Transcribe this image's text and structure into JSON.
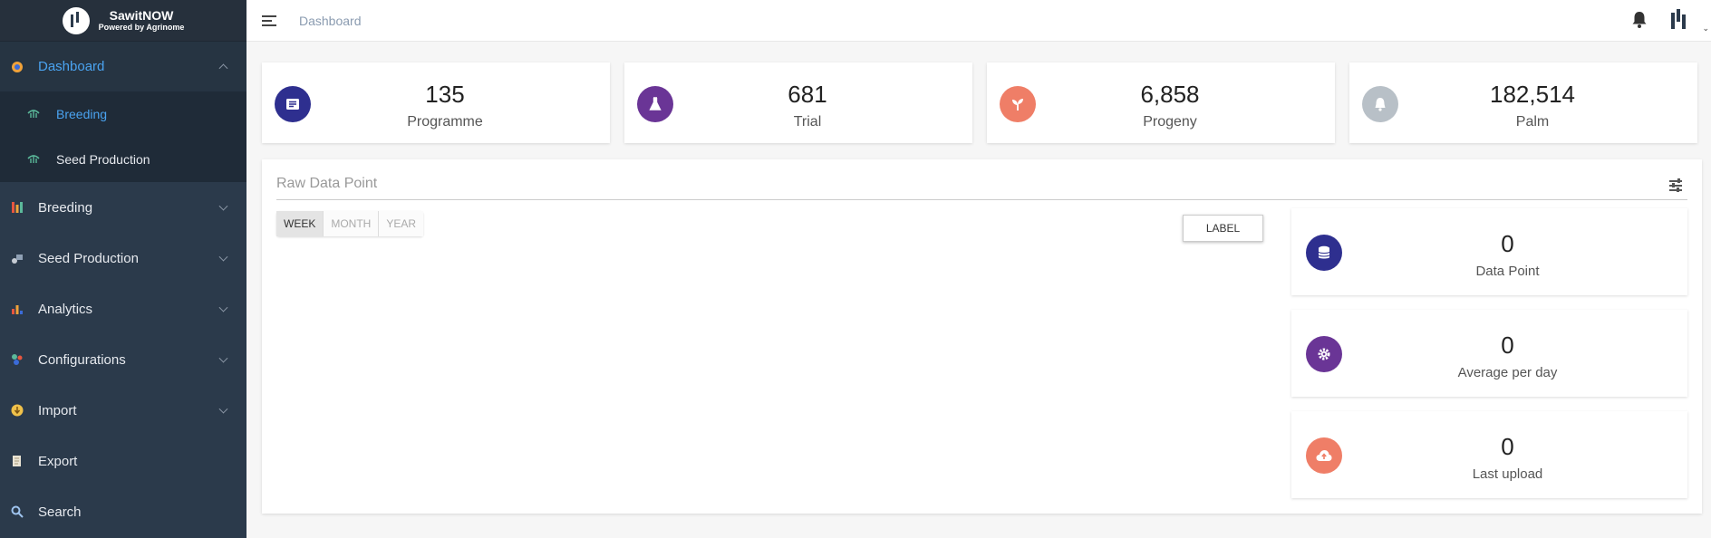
{
  "brand": {
    "name": "SawitNOW",
    "sub": "Powered by Agrinome"
  },
  "sidebar": {
    "items": [
      {
        "label": "Dashboard",
        "icon": "dashboard-icon",
        "color": "#4aa3f0",
        "active": true,
        "children": [
          {
            "label": "Breeding",
            "icon": "breeding-icon",
            "active": true
          },
          {
            "label": "Seed Production",
            "icon": "seed-production-icon",
            "active": false
          }
        ]
      },
      {
        "label": "Breeding",
        "icon": "breeding-icon"
      },
      {
        "label": "Seed Production",
        "icon": "seed-production-icon"
      },
      {
        "label": "Analytics",
        "icon": "analytics-icon"
      },
      {
        "label": "Configurations",
        "icon": "configurations-icon"
      },
      {
        "label": "Import",
        "icon": "import-icon"
      },
      {
        "label": "Export",
        "icon": "export-icon"
      },
      {
        "label": "Search",
        "icon": "search-icon"
      }
    ]
  },
  "topbar": {
    "breadcrumb": "Dashboard"
  },
  "stats": [
    {
      "value": "135",
      "label": "Programme",
      "icon": "list-icon",
      "color": "#2e2f8f"
    },
    {
      "value": "681",
      "label": "Trial",
      "icon": "flask-icon",
      "color": "#6a3596"
    },
    {
      "value": "6,858",
      "label": "Progeny",
      "icon": "sprout-icon",
      "color": "#ef7e67"
    },
    {
      "value": "182,514",
      "label": "Palm",
      "icon": "palm-icon",
      "color": "#b8c0c7"
    }
  ],
  "raw_data": {
    "title": "Raw Data Point",
    "periods": [
      "WEEK",
      "MONTH",
      "YEAR"
    ],
    "selected_period": "WEEK",
    "label_button": "LABEL",
    "cards": [
      {
        "value": "0",
        "label": "Data Point",
        "icon": "database-icon",
        "color": "#2e2f8f"
      },
      {
        "value": "0",
        "label": "Average per day",
        "icon": "gear-icon",
        "color": "#6a3596"
      },
      {
        "value": "0",
        "label": "Last upload",
        "icon": "cloud-upload-icon",
        "color": "#ef7e67"
      }
    ]
  }
}
